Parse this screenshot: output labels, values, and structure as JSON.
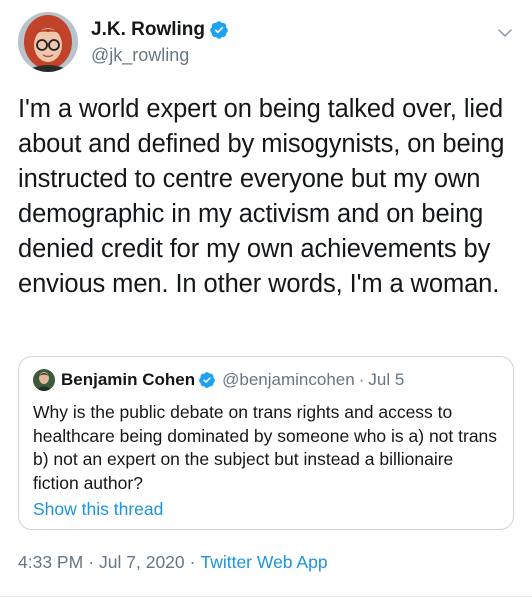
{
  "tweet": {
    "author_name": "J.K. Rowling",
    "author_handle": "@jk_rowling",
    "text": "I'm a world expert on being talked over, lied about and defined by misogynists, on being instructed to centre everyone but my own demographic in my activism and on being denied credit for my own achievements by envious men. In other words, I'm a woman.",
    "time": "4:33 PM",
    "date": "Jul 7, 2020",
    "separator": "·",
    "source_app": "Twitter Web App"
  },
  "quoted_tweet": {
    "author_name": "Benjamin Cohen",
    "author_handle": "@benjamincohen",
    "separator": "·",
    "date": "Jul 5",
    "text": "Why is the public debate on trans rights and access to healthcare being dominated by someone who is a) not trans b) not an expert on the subject but instead a billionaire fiction author?",
    "show_thread_label": "Show this thread"
  },
  "icons": {
    "verified": "verified-badge-icon",
    "menu": "chevron-down-icon"
  },
  "colors": {
    "text": "#14171a",
    "secondary": "#657786",
    "link": "#1b95e0",
    "border": "#ccd6dd",
    "verified": "#1da1f2"
  }
}
